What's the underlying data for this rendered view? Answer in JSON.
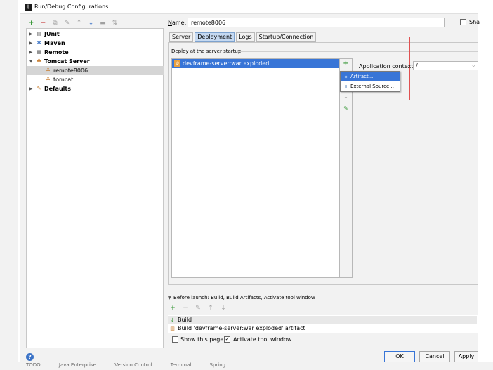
{
  "window": {
    "title": "Run/Debug Configurations"
  },
  "toolbar": {
    "add_icon": "+",
    "remove_icon": "−",
    "copy_icon": "⧉",
    "settings_icon": "✎",
    "up_icon": "↑",
    "down_icon": "↓",
    "folder_icon": "▬",
    "sort_icon": "⇅"
  },
  "tree": {
    "items": [
      {
        "label": "JUnit",
        "icon": "▤"
      },
      {
        "label": "Maven",
        "icon": "✱"
      },
      {
        "label": "Remote",
        "icon": "▦"
      },
      {
        "label": "Tomcat Server",
        "icon": "☘"
      },
      {
        "label": "remote8006",
        "icon": "☘"
      },
      {
        "label": "tomcat",
        "icon": "☘"
      },
      {
        "label": "Defaults",
        "icon": "✎"
      }
    ]
  },
  "form": {
    "name_label_first": "N",
    "name_label_rest": "ame:",
    "name_value": "remote8006",
    "share_label_first": "S",
    "share_label_rest": "ha"
  },
  "tabs": [
    {
      "label": "Server"
    },
    {
      "label": "Deployment"
    },
    {
      "label": "Logs"
    },
    {
      "label": "Startup/Connection"
    }
  ],
  "deployment": {
    "section_label": "Deploy at the server startup",
    "item_label": "devframe-server:war exploded",
    "item_icon": "⚙",
    "add_icon": "+",
    "move_down_icon": "↓",
    "edit_icon": "✎",
    "popup": {
      "artifact_label": "Artifact...",
      "external_label": "External Source..."
    },
    "context_label": "Application context:",
    "context_value": "/",
    "context_chevron": "⌵"
  },
  "before_launch": {
    "collapse_icon": "▼",
    "label_first": "B",
    "label_rest": "efore launch: Build, Build Artifacts, Activate tool window",
    "add_icon": "+",
    "remove_icon": "−",
    "edit_icon": "✎",
    "up_icon": "↑",
    "down_icon": "↓",
    "items": [
      {
        "label": "Build",
        "icon": "↓"
      },
      {
        "label": "Build 'devframe-server:war exploded' artifact",
        "icon": "▥"
      }
    ],
    "show_page_label": "Show this page",
    "activate_label": "Activate tool window",
    "activate_check": "✓"
  },
  "buttons": {
    "help_icon": "?",
    "ok": "OK",
    "cancel": "Cancel",
    "apply_first": "A",
    "apply_rest": "pply"
  },
  "ide_bottom": [
    "TODO",
    "Java Enterprise",
    "Version Control",
    "Terminal",
    "Spring"
  ],
  "colors": {
    "selection": "#3875d7",
    "tab_active": "#c5d9f1",
    "annotation_box": "#e05050",
    "add_green": "#3c9a3c"
  }
}
